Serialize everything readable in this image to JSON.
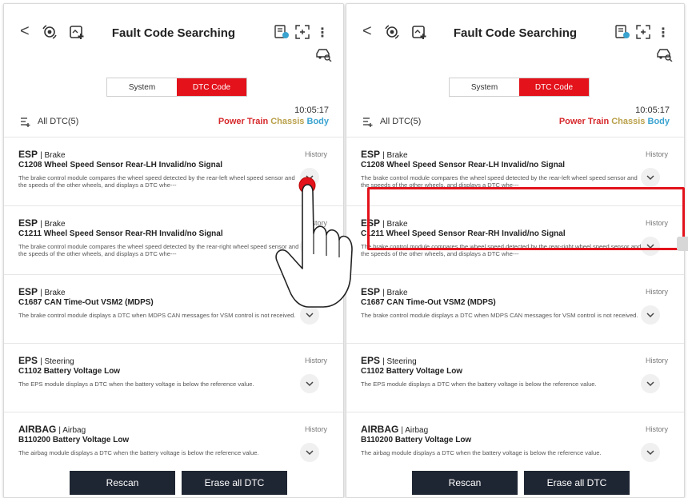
{
  "screen": {
    "title": "Fault Code Searching",
    "back_label": "<",
    "more_label": "⋮",
    "segments": {
      "system": "System",
      "dtc": "DTC Code"
    },
    "time": "10:05:17",
    "all_dtc": "All DTC(5)",
    "categories": {
      "power_train": "Power Train",
      "chassis": "Chassis",
      "body": "Body"
    },
    "history_label": "History",
    "buttons": {
      "rescan": "Rescan",
      "erase": "Erase all DTC"
    },
    "items": [
      {
        "system": "ESP",
        "subsystem": "Brake",
        "code": "C1208 Wheel Speed Sensor Rear-LH Invalid/no Signal",
        "desc": "The brake control module compares the wheel speed detected by the rear-left wheel speed sensor and the speeds of the other wheels, and displays a DTC whe---"
      },
      {
        "system": "ESP",
        "subsystem": "Brake",
        "code": "C1211 Wheel Speed Sensor Rear-RH Invalid/no Signal",
        "desc": "The brake control module compares the wheel speed detected by the rear-right wheel speed sensor and the speeds of the other wheels, and displays a DTC whe---"
      },
      {
        "system": "ESP",
        "subsystem": "Brake",
        "code": "C1687 CAN Time-Out VSM2 (MDPS)",
        "desc": "The brake control module displays a DTC when MDPS CAN messages for VSM control is not received."
      },
      {
        "system": "EPS",
        "subsystem": "Steering",
        "code": "C1102 Battery Voltage Low",
        "desc": "The EPS module displays a DTC when the battery voltage is below the reference value."
      },
      {
        "system": "AIRBAG",
        "subsystem": "Airbag",
        "code": "B110200 Battery Voltage Low",
        "desc": "The airbag module displays a DTC when the battery voltage is below the reference value."
      }
    ]
  },
  "icons": {
    "back": "back-icon",
    "connection": "vci-connection-icon",
    "add": "add-vehicle-icon",
    "report": "report-icon",
    "scan": "scan-frame-icon",
    "more": "more-icon",
    "car": "car-search-icon",
    "filter": "filter-icon",
    "chevron": "chevron-down-icon",
    "hand": "tap-hand-icon"
  },
  "colors": {
    "accent": "#e3121b",
    "power_train": "#d6282b",
    "chassis": "#b9a04a",
    "body": "#3aa3d0",
    "button": "#1f2633"
  }
}
